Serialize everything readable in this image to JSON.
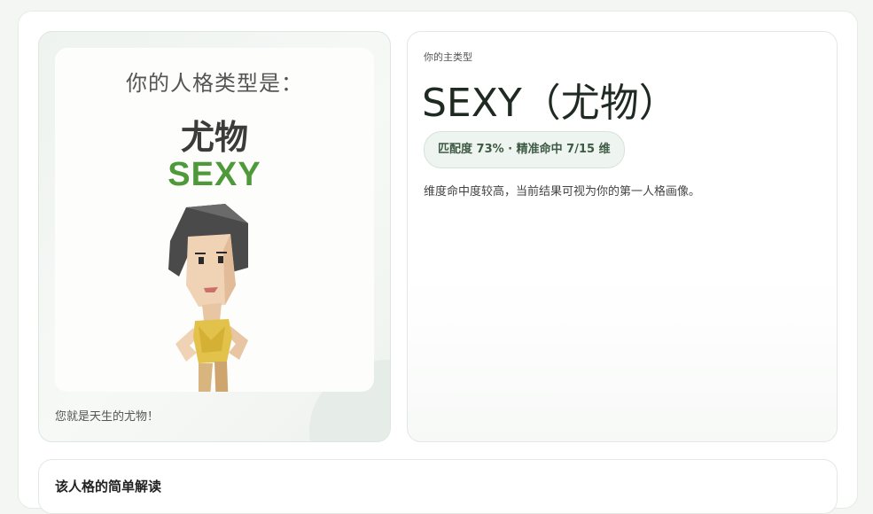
{
  "personality_image": {
    "heading": "你的人格类型是：",
    "name_cn": "尤物",
    "name_en": "SEXY",
    "caption": "您就是天生的尤物！"
  },
  "result": {
    "eyebrow": "你的主类型",
    "title": "SEXY（尤物）",
    "match_badge": "匹配度 73% · 精准命中 7/15 维",
    "description": "维度命中度较高，当前结果可视为你的第一人格画像。"
  },
  "interpretation": {
    "title": "该人格的简单解读"
  },
  "colors": {
    "accent_green": "#4e9a3a",
    "badge_bg": "#eef4ef",
    "badge_text": "#3e5a44"
  }
}
